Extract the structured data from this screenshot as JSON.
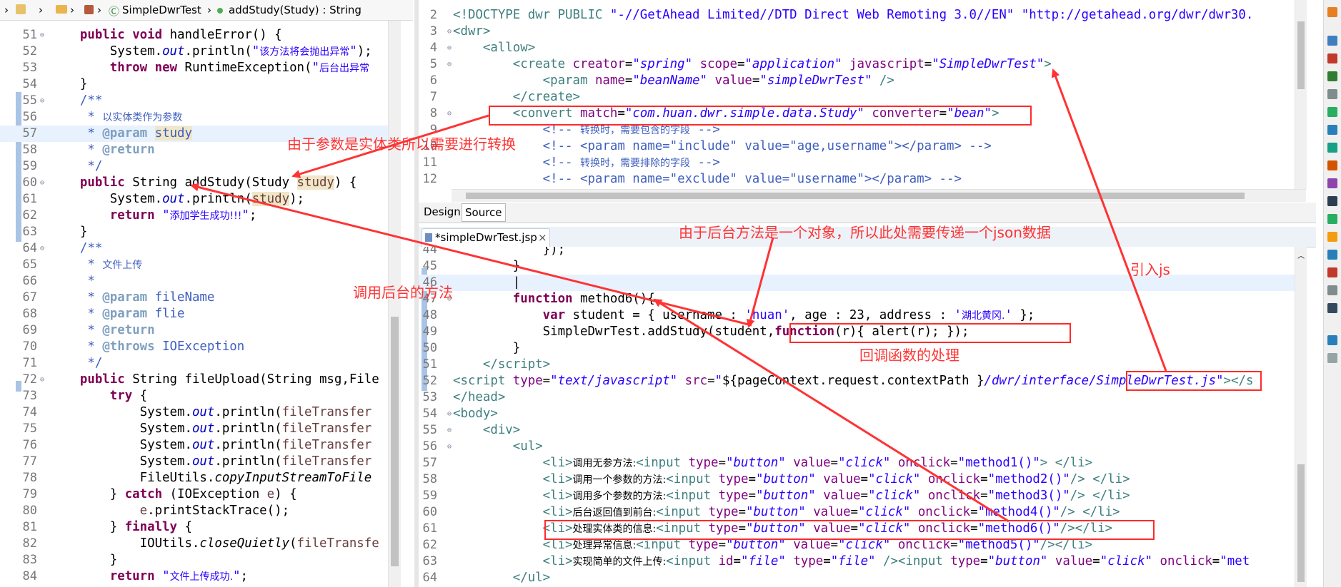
{
  "breadcrumb": {
    "project": "SimpleDwrTest",
    "method": "addStudy(Study) : String"
  },
  "java": {
    "lines": [
      {
        "n": "51",
        "fold": "⊖",
        "html": "    <span class='kw'>public</span> <span class='kw'>void</span> handleError() {"
      },
      {
        "n": "52",
        "html": "        System.<span class='fld'>out</span>.println(<span class='str'>\"<span class='cn'>该方法将会抛出异常</span>\"</span>);"
      },
      {
        "n": "53",
        "html": "        <span class='kw'>throw</span> <span class='kw'>new</span> RuntimeException(<span class='str'>\"<span class='cn'>后台出异常</span></span>"
      },
      {
        "n": "54",
        "html": "    }"
      },
      {
        "n": "55",
        "fold": "⊖",
        "html": "    <span class='cm'>/**</span>"
      },
      {
        "n": "56",
        "html": "     <span class='cm'>* <span class='cn'>以实体类作为参数</span></span>"
      },
      {
        "n": "57",
        "hl": true,
        "html": "     <span class='cm'>* <b style='color:#7f9fbf'>@param</b> <span class='occ'>study</span></span>"
      },
      {
        "n": "58",
        "html": "     <span class='cm'>* <b style='color:#7f9fbf'>@return</b></span>"
      },
      {
        "n": "59",
        "html": "     <span class='cm'>*/</span>"
      },
      {
        "n": "60",
        "fold": "⊖",
        "html": "    <span class='kw'>public</span> String addStudy(Study <span class='occ var'>study</span>) {"
      },
      {
        "n": "61",
        "html": "        System.<span class='fld'>out</span>.println(<span class='occ var'>study</span>);"
      },
      {
        "n": "62",
        "html": "        <span class='kw'>return</span> <span class='str'>\"<span class='cn'>添加学生成功!!!</span>\"</span>;"
      },
      {
        "n": "63",
        "html": "    }"
      },
      {
        "n": "64",
        "fold": "⊖",
        "html": "    <span class='cm'>/**</span>"
      },
      {
        "n": "65",
        "html": "     <span class='cm'>* <span class='cn'>文件上传</span></span>"
      },
      {
        "n": "66",
        "html": "     <span class='cm'>*</span>"
      },
      {
        "n": "67",
        "html": "     <span class='cm'>* <b style='color:#7f9fbf'>@param</b> fileName</span>"
      },
      {
        "n": "68",
        "html": "     <span class='cm'>* <b style='color:#7f9fbf'>@param</b> flie</span>"
      },
      {
        "n": "69",
        "html": "     <span class='cm'>* <b style='color:#7f9fbf'>@return</b></span>"
      },
      {
        "n": "70",
        "html": "     <span class='cm'>* <b style='color:#7f9fbf'>@throws</b> IOException</span>"
      },
      {
        "n": "71",
        "html": "     <span class='cm'>*/</span>"
      },
      {
        "n": "72",
        "fold": "⊖",
        "html": "    <span class='kw'>public</span> String fileUpload(String msg,File"
      },
      {
        "n": "73",
        "html": "        <span class='kw'>try</span> {"
      },
      {
        "n": "74",
        "html": "            System.<span class='fld'>out</span>.println(<span class='var'>fileTransfer</span>"
      },
      {
        "n": "75",
        "html": "            System.<span class='fld'>out</span>.println(<span class='var'>fileTransfer</span>"
      },
      {
        "n": "76",
        "html": "            System.<span class='fld'>out</span>.println(<span class='var'>fileTransfer</span>"
      },
      {
        "n": "77",
        "html": "            System.<span class='fld'>out</span>.println(<span class='var'>fileTransfer</span>"
      },
      {
        "n": "78",
        "html": "            FileUtils.<span class='it'>copyInputStreamToFile</span>"
      },
      {
        "n": "79",
        "html": "        } <span class='kw'>catch</span> (IOException <span class='var'>e</span>) {"
      },
      {
        "n": "80",
        "html": "            <span class='var'>e</span>.printStackTrace();"
      },
      {
        "n": "81",
        "html": "        } <span class='kw'>finally</span> {"
      },
      {
        "n": "82",
        "html": "            IOUtils.<span class='it'>closeQuietly</span>(<span class='var'>fileTransfe</span>"
      },
      {
        "n": "83",
        "html": "        }"
      },
      {
        "n": "84",
        "html": "        <span class='kw'>return</span> <span class='str'>\"<span class='cn'>文件上传成功.</span>\"</span>;"
      }
    ]
  },
  "xml": {
    "lines": [
      {
        "n": "2",
        "html": "<span class='tag'>&lt;!DOCTYPE dwr PUBLIC</span> <span class='str'>\"-//GetAhead Limited//DTD Direct Web Remoting 3.0//EN\"</span> <span class='str'>\"http://getahead.org/dwr/dwr30.</span>"
      },
      {
        "n": "3",
        "fold": "⊖",
        "html": "<span class='tag'>&lt;dwr&gt;</span>"
      },
      {
        "n": "4",
        "fold": "⊖",
        "html": "    <span class='tag'>&lt;allow&gt;</span>"
      },
      {
        "n": "5",
        "fold": "⊖",
        "html": "        <span class='tag'>&lt;create</span> <span class='attr'>creator</span>=<span class='aval'>\"spring\"</span> <span class='attr'>scope</span>=<span class='aval'>\"application\"</span> <span class='attr'>javascript</span>=<span class='aval'>\"SimpleDwrTest\"</span><span class='tag'>&gt;</span>"
      },
      {
        "n": "6",
        "html": "            <span class='tag'>&lt;param</span> <span class='attr'>name</span>=<span class='aval'>\"beanName\"</span> <span class='attr'>value</span>=<span class='aval'>\"simpleDwrTest\"</span> <span class='tag'>/&gt;</span>"
      },
      {
        "n": "7",
        "html": "        <span class='tag'>&lt;/create&gt;</span>"
      },
      {
        "n": "8",
        "fold": "⊖",
        "html": "        <span class='tag'>&lt;convert</span> <span class='attr'>match</span>=<span class='aval'>\"com.huan.dwr.simple.data.Study\"</span> <span class='attr'>converter</span>=<span class='aval'>\"bean\"</span><span class='tag'>&gt;</span>"
      },
      {
        "n": "9",
        "html": "            <span class='xmlc'>&lt;!-- <span class='cn'>转换时，需要包含的字段</span> --&gt;</span>"
      },
      {
        "n": "10",
        "html": "            <span class='xmlc'>&lt;!-- &lt;param name=\"include\" value=\"age,username\"&gt;&lt;/param&gt; --&gt;</span>"
      },
      {
        "n": "11",
        "html": "            <span class='xmlc'>&lt;!-- <span class='cn'>转换时，需要排除的字段</span> --&gt;</span>"
      },
      {
        "n": "12",
        "html": "            <span class='xmlc'>&lt;!-- &lt;param name=\"exclude\" value=\"username\"&gt;&lt;/param&gt; --&gt;</span>"
      }
    ],
    "design_tab": "Design",
    "source_tab": "Source"
  },
  "jsp": {
    "tab_label": "*simpleDwrTest.jsp",
    "lines": [
      {
        "n": "44",
        "html": "            });"
      },
      {
        "n": "45",
        "html": "        }"
      },
      {
        "n": "46",
        "hl": true,
        "html": "        |"
      },
      {
        "n": "47",
        "fold": "⊖",
        "html": "        <span class='kw'>function</span> method6(){"
      },
      {
        "n": "48",
        "html": "            <span class='kw'>var</span> student = { username : <span class='str'>'huan'</span>, age : 23, address : <span class='str'>'<span class='cn'>湖北黄冈.</span>'</span> };"
      },
      {
        "n": "49",
        "html": "            SimpleDwrTest.addStudy(student,<span class='kw'>function</span>(r){ alert(r); });"
      },
      {
        "n": "50",
        "html": "        }"
      },
      {
        "n": "51",
        "html": "    <span class='tag'>&lt;/script&gt;</span>"
      },
      {
        "n": "52",
        "html": "<span class='tag'>&lt;script</span> <span class='attr'>type</span>=<span class='aval'>\"text/javascript\"</span> <span class='attr'>src</span>=<span class='str'>\"</span>${pageContext.request.contextPath }<span class='aval'>/dwr/interface/SimpleDwrTest.js\"</span><span class='tag'>&gt;&lt;/s</span>"
      },
      {
        "n": "53",
        "html": "<span class='tag'>&lt;/head&gt;</span>"
      },
      {
        "n": "54",
        "fold": "⊖",
        "html": "<span class='tag'>&lt;body&gt;</span>"
      },
      {
        "n": "55",
        "fold": "⊖",
        "html": "    <span class='tag'>&lt;div&gt;</span>"
      },
      {
        "n": "56",
        "fold": "⊖",
        "html": "        <span class='tag'>&lt;ul&gt;</span>"
      },
      {
        "n": "57",
        "html": "            <span class='tag'>&lt;li&gt;</span><span class='cn'>调用无参方法:</span><span class='tag'>&lt;input</span> <span class='attr'>type</span>=<span class='aval'>\"button\"</span> <span class='attr'>value</span>=<span class='aval'>\"click\"</span> <span class='attr'>onclick</span>=<span class='str'>\"method1()\"</span><span class='tag'>&gt;</span> <span class='tag'>&lt;/li&gt;</span>"
      },
      {
        "n": "58",
        "html": "            <span class='tag'>&lt;li&gt;</span><span class='cn'>调用一个参数的方法:</span><span class='tag'>&lt;input</span> <span class='attr'>type</span>=<span class='aval'>\"button\"</span> <span class='attr'>value</span>=<span class='aval'>\"click\"</span> <span class='attr'>onclick</span>=<span class='str'>\"method2()\"</span><span class='tag'>/&gt;</span> <span class='tag'>&lt;/li&gt;</span>"
      },
      {
        "n": "59",
        "html": "            <span class='tag'>&lt;li&gt;</span><span class='cn'>调用多个参数的方法:</span><span class='tag'>&lt;input</span> <span class='attr'>type</span>=<span class='aval'>\"button\"</span> <span class='attr'>value</span>=<span class='aval'>\"click\"</span> <span class='attr'>onclick</span>=<span class='str'>\"method3()\"</span><span class='tag'>/&gt;</span> <span class='tag'>&lt;/li&gt;</span>"
      },
      {
        "n": "60",
        "html": "            <span class='tag'>&lt;li&gt;</span><span class='cn'>后台返回值到前台:</span><span class='tag'>&lt;input</span> <span class='attr'>type</span>=<span class='aval'>\"button\"</span> <span class='attr'>value</span>=<span class='aval'>\"click\"</span> <span class='attr'>onclick</span>=<span class='str'>\"method4()\"</span><span class='tag'>/&gt;</span> <span class='tag'>&lt;/li&gt;</span>"
      },
      {
        "n": "61",
        "html": "            <span class='tag'>&lt;li&gt;</span><span class='cn'>处理实体类的信息:</span><span class='tag'>&lt;input</span> <span class='attr'>type</span>=<span class='aval'>\"button\"</span> <span class='attr'>value</span>=<span class='aval'>\"click\"</span> <span class='attr'>onclick</span>=<span class='str'>\"method6()\"</span><span class='tag'>/&gt;&lt;/li&gt;</span>"
      },
      {
        "n": "62",
        "html": "            <span class='tag'>&lt;li&gt;</span><span class='cn'>处理异常信息:</span><span class='tag'>&lt;input</span> <span class='attr'>type</span>=<span class='aval'>\"button\"</span> <span class='attr'>value</span>=<span class='aval'>\"click\"</span> <span class='attr'>onclick</span>=<span class='str'>\"method5()\"</span><span class='tag'>/&gt;&lt;/li&gt;</span>"
      },
      {
        "n": "63",
        "html": "            <span class='tag'>&lt;li&gt;</span><span class='cn'>实现简单的文件上传:</span><span class='tag'>&lt;input</span> <span class='attr'>id</span>=<span class='aval'>\"file\"</span> <span class='attr'>type</span>=<span class='aval'>\"file\"</span> <span class='tag'>/&gt;&lt;input</span> <span class='attr'>type</span>=<span class='aval'>\"button\"</span> <span class='attr'>value</span>=<span class='aval'>\"click\"</span> <span class='attr'>onclick</span>=<span class='str'>\"met</span>"
      },
      {
        "n": "64",
        "html": "        <span class='tag'>&lt;/ul&gt;</span>"
      }
    ]
  },
  "annotations": {
    "convert_note": "由于参数是实体类所以需要进行转换",
    "json_note": "由于后台方法是一个对象，所以此处需要传递一个json数据",
    "import_js": "引入js",
    "call_backend": "调用后台的方法",
    "callback": "回调函数的处理"
  },
  "colors": {
    "annotation": "#ff3333",
    "keyword": "#7f0055",
    "string": "#2a00ff",
    "comment": "#3f5fbf",
    "tag": "#3f7f7f",
    "attribute": "#7f007f"
  }
}
